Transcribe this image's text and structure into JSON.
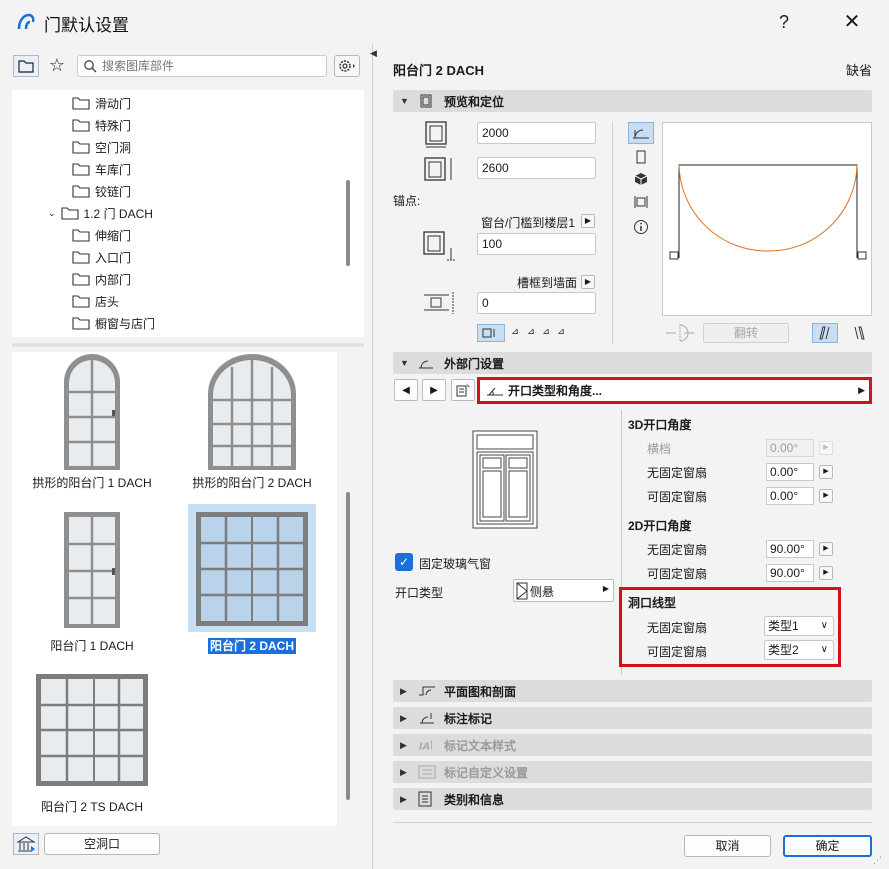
{
  "window": {
    "title": "门默认设置",
    "help": "?",
    "close": "✕"
  },
  "search": {
    "placeholder": "搜索图库部件",
    "value": ""
  },
  "tree": {
    "items": [
      {
        "label": "滑动门"
      },
      {
        "label": "特殊门"
      },
      {
        "label": "空门洞"
      },
      {
        "label": "车库门"
      },
      {
        "label": "铰链门"
      },
      {
        "label": "1.2 门 DACH"
      },
      {
        "label": "伸缩门"
      },
      {
        "label": "入口门"
      },
      {
        "label": "内部门"
      },
      {
        "label": "店头"
      },
      {
        "label": "橱窗与店门"
      }
    ]
  },
  "thumbnails": [
    {
      "label": "拱形的阳台门 1 DACH"
    },
    {
      "label": "拱形的阳台门 2 DACH"
    },
    {
      "label": "阳台门 1 DACH"
    },
    {
      "label": "阳台门 2 DACH"
    },
    {
      "label": "阳台门 2 TS DACH"
    }
  ],
  "left_bottom": {
    "empty_opening": "空洞口"
  },
  "object": {
    "name": "阳台门 2 DACH",
    "default": "缺省"
  },
  "sections": {
    "preview": "预览和定位",
    "door_settings": "外部门设置",
    "plan_section": "平面图和剖面",
    "dimension_marker": "标注标记",
    "marker_text_style": "标记文本样式",
    "marker_custom": "标记自定义设置",
    "category_info": "类别和信息"
  },
  "preview": {
    "width": "2000",
    "height": "2600",
    "anchor_label": "锚点:",
    "sill_label": "窗台/门槛到楼层1",
    "sill_value": "100",
    "reveal_label": "槽框到墙面",
    "reveal_value": "0",
    "flip": "翻转"
  },
  "door_settings": {
    "page": "开口类型和角度...",
    "fixed_glass_label": "固定玻璃气窗",
    "fixed_glass_checked": true,
    "open_type_label": "开口类型",
    "open_type_value": "侧悬"
  },
  "angles_3d": {
    "title": "3D开口角度",
    "rows": [
      {
        "label": "横档",
        "value": "0.00°",
        "disabled": true
      },
      {
        "label": "无固定窗扇",
        "value": "0.00°"
      },
      {
        "label": "可固定窗扇",
        "value": "0.00°"
      }
    ]
  },
  "angles_2d": {
    "title": "2D开口角度",
    "rows": [
      {
        "label": "无固定窗扇",
        "value": "90.00°"
      },
      {
        "label": "可固定窗扇",
        "value": "90.00°"
      }
    ]
  },
  "opening_line": {
    "title": "洞口线型",
    "rows": [
      {
        "label": "无固定窗扇",
        "value": "类型1"
      },
      {
        "label": "可固定窗扇",
        "value": "类型2"
      }
    ]
  },
  "buttons": {
    "cancel": "取消",
    "ok": "确定"
  },
  "colors": {
    "accent": "#1a6fd8",
    "highlight": "#d0131b",
    "swing_arc": "#e07020"
  }
}
